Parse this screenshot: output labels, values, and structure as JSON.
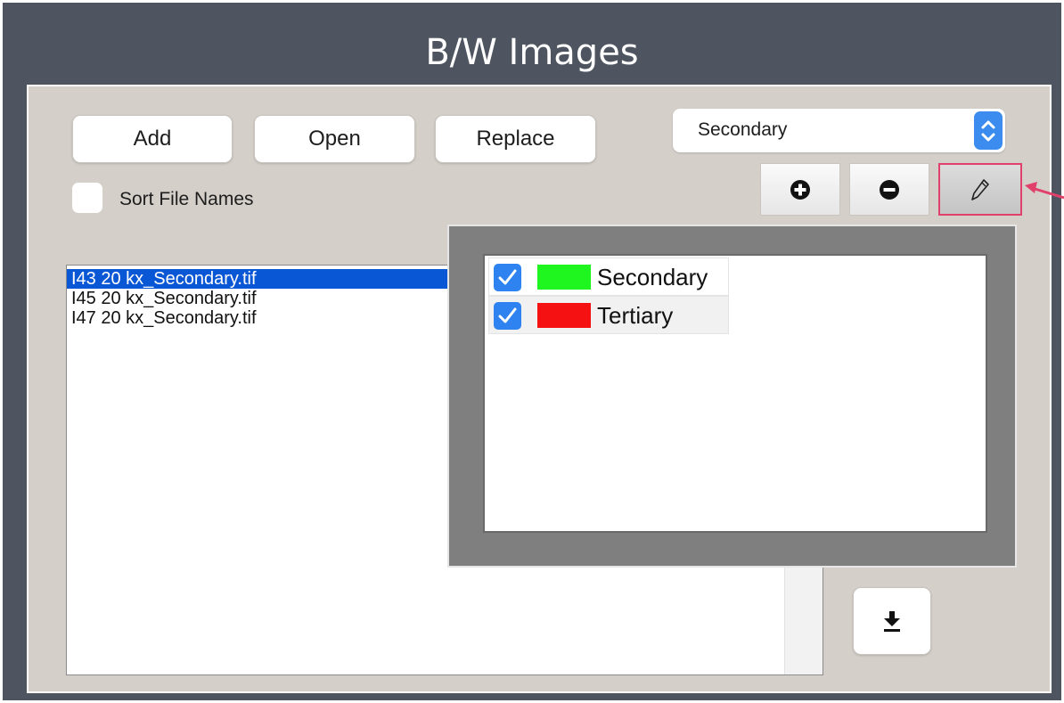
{
  "window": {
    "title": "B/W Images"
  },
  "toolbar": {
    "add_label": "Add",
    "open_label": "Open",
    "replace_label": "Replace"
  },
  "channel_select": {
    "value": "Secondary"
  },
  "sort": {
    "label": "Sort File Names",
    "checked": false
  },
  "tools": {
    "add_icon": "plus-circle-icon",
    "remove_icon": "minus-circle-icon",
    "edit_icon": "pencil-icon",
    "edit_active": true
  },
  "file_list": {
    "items": [
      "I43 20 kx_Secondary.tif",
      "I45 20 kx_Secondary.tif",
      "I47 20 kx_Secondary.tif"
    ],
    "selected_index": 0
  },
  "layers": [
    {
      "name": "Secondary",
      "checked": true,
      "color": "#1ff51f"
    },
    {
      "name": "Tertiary",
      "checked": true,
      "color": "#f51111"
    }
  ],
  "download": {
    "icon": "download-icon"
  },
  "colors": {
    "titlebar": "#4f5560",
    "panel": "#d4cfc9",
    "accent": "#3c8cf0",
    "selection": "#0a57d6",
    "highlight": "#e0406a"
  }
}
